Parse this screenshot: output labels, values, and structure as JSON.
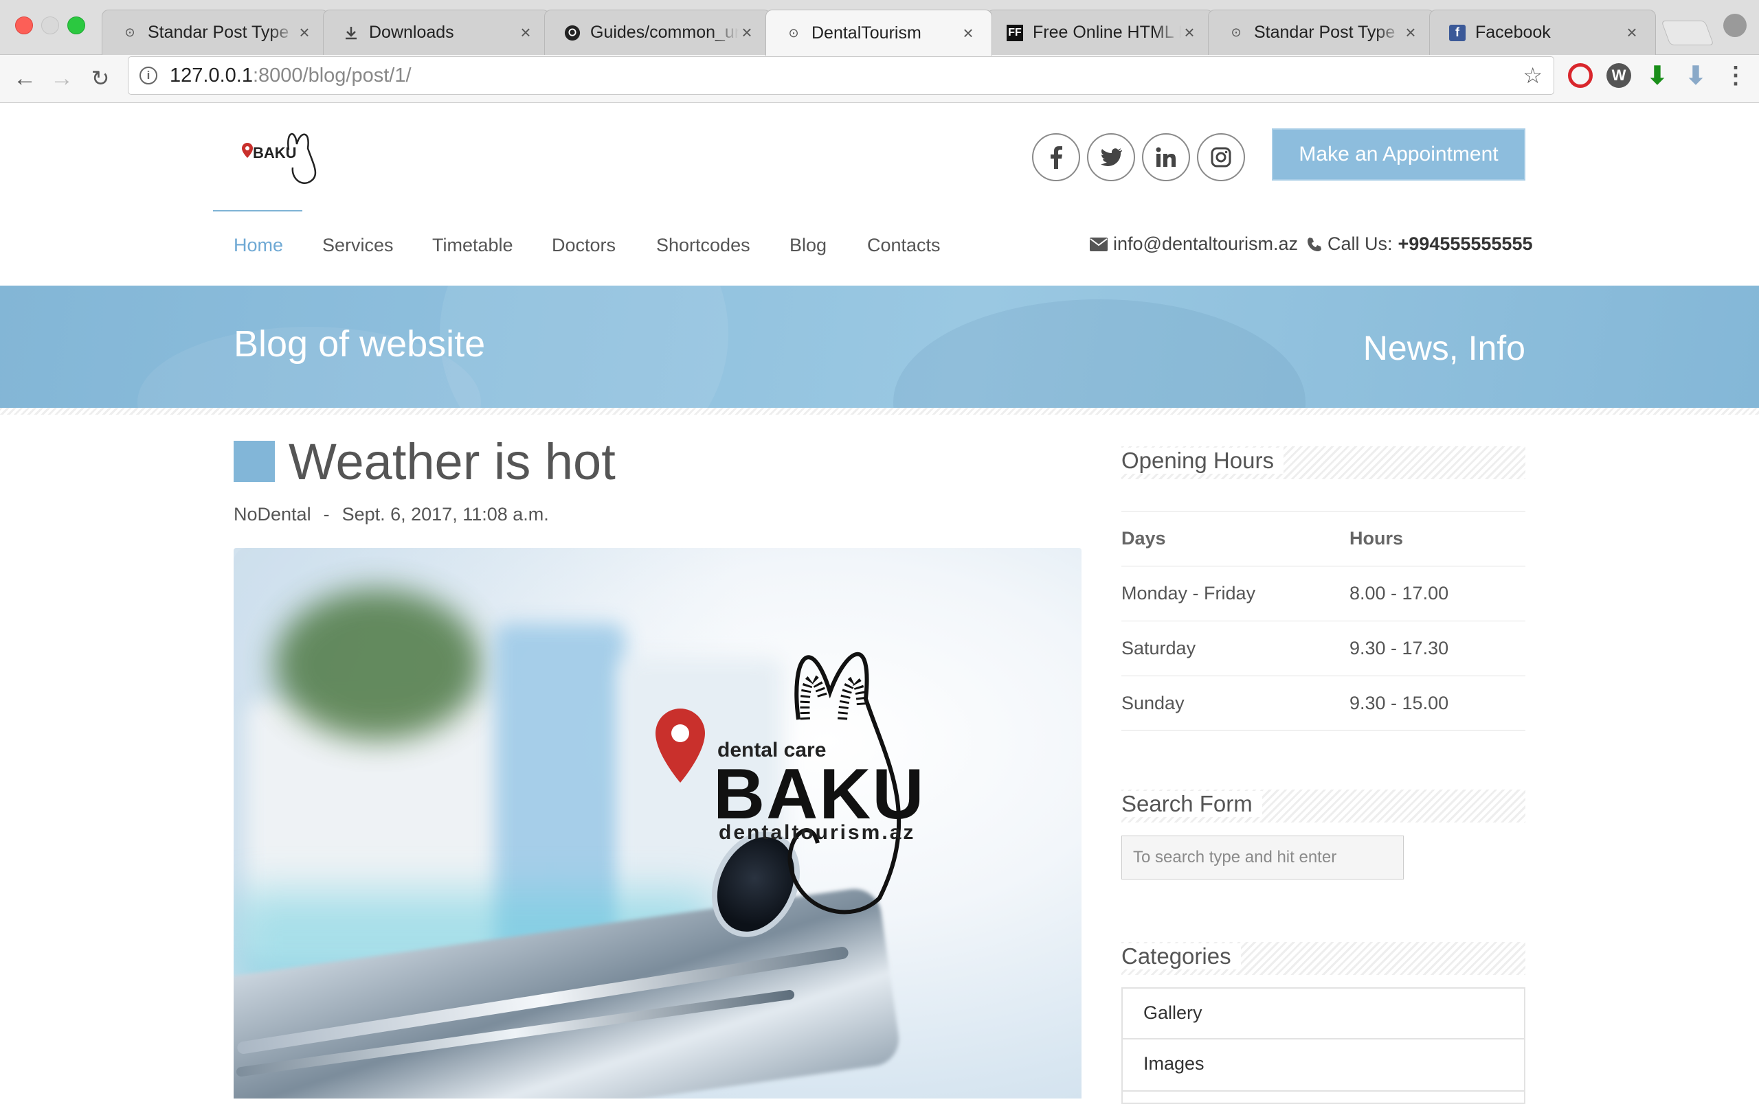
{
  "browser": {
    "tabs": [
      {
        "title": "Standar Post Type",
        "icon": "generic-site-icon"
      },
      {
        "title": "Downloads",
        "icon": "download-icon"
      },
      {
        "title": "Guides/common_ur",
        "icon": "github-icon"
      },
      {
        "title": "DentalTourism",
        "icon": "generic-site-icon"
      },
      {
        "title": "Free Online HTML I",
        "icon": "ff-site-icon"
      },
      {
        "title": "Standar Post Type",
        "icon": "generic-site-icon"
      },
      {
        "title": "Facebook",
        "icon": "facebook-icon"
      }
    ],
    "active_tab_index": 3,
    "close_glyph": "×",
    "url_host": "127.0.0.1",
    "url_rest": ":8000/blog/post/1/"
  },
  "header": {
    "logo_alt": "BAKU",
    "social": [
      {
        "name": "facebook",
        "glyph": "f"
      },
      {
        "name": "twitter",
        "glyph": "t"
      },
      {
        "name": "linkedin",
        "glyph": "in"
      },
      {
        "name": "instagram",
        "glyph": "ig"
      }
    ],
    "appointment_label": "Make an Appointment",
    "nav": [
      "Home",
      "Services",
      "Timetable",
      "Doctors",
      "Shortcodes",
      "Blog",
      "Contacts"
    ],
    "active_nav": "Home",
    "email": "info@dentaltourism.az",
    "call_label": "Call Us:",
    "phone": "+994555555555",
    "accent_color": "#8dbddd"
  },
  "banner": {
    "title": "Blog of website",
    "subtitle": "News, Info"
  },
  "post": {
    "title": "Weather is hot",
    "author": "NoDental",
    "separator": "-",
    "date": "Sept. 6, 2017, 11:08 a.m.",
    "image": {
      "brand_tagline": "dental care",
      "brand_name": "BAKU",
      "brand_site": "dentaltourism.az"
    }
  },
  "sidebar": {
    "opening_hours": {
      "title": "Opening Hours",
      "col_days": "Days",
      "col_hours": "Hours",
      "rows": [
        {
          "day": "Monday - Friday",
          "hours": "8.00 - 17.00"
        },
        {
          "day": "Saturday",
          "hours": "9.30 - 17.30"
        },
        {
          "day": "Sunday",
          "hours": "9.30 - 15.00"
        }
      ]
    },
    "search": {
      "title": "Search Form",
      "placeholder": "To search type and hit enter"
    },
    "categories": {
      "title": "Categories",
      "items": [
        "Gallery",
        "Images"
      ]
    }
  }
}
